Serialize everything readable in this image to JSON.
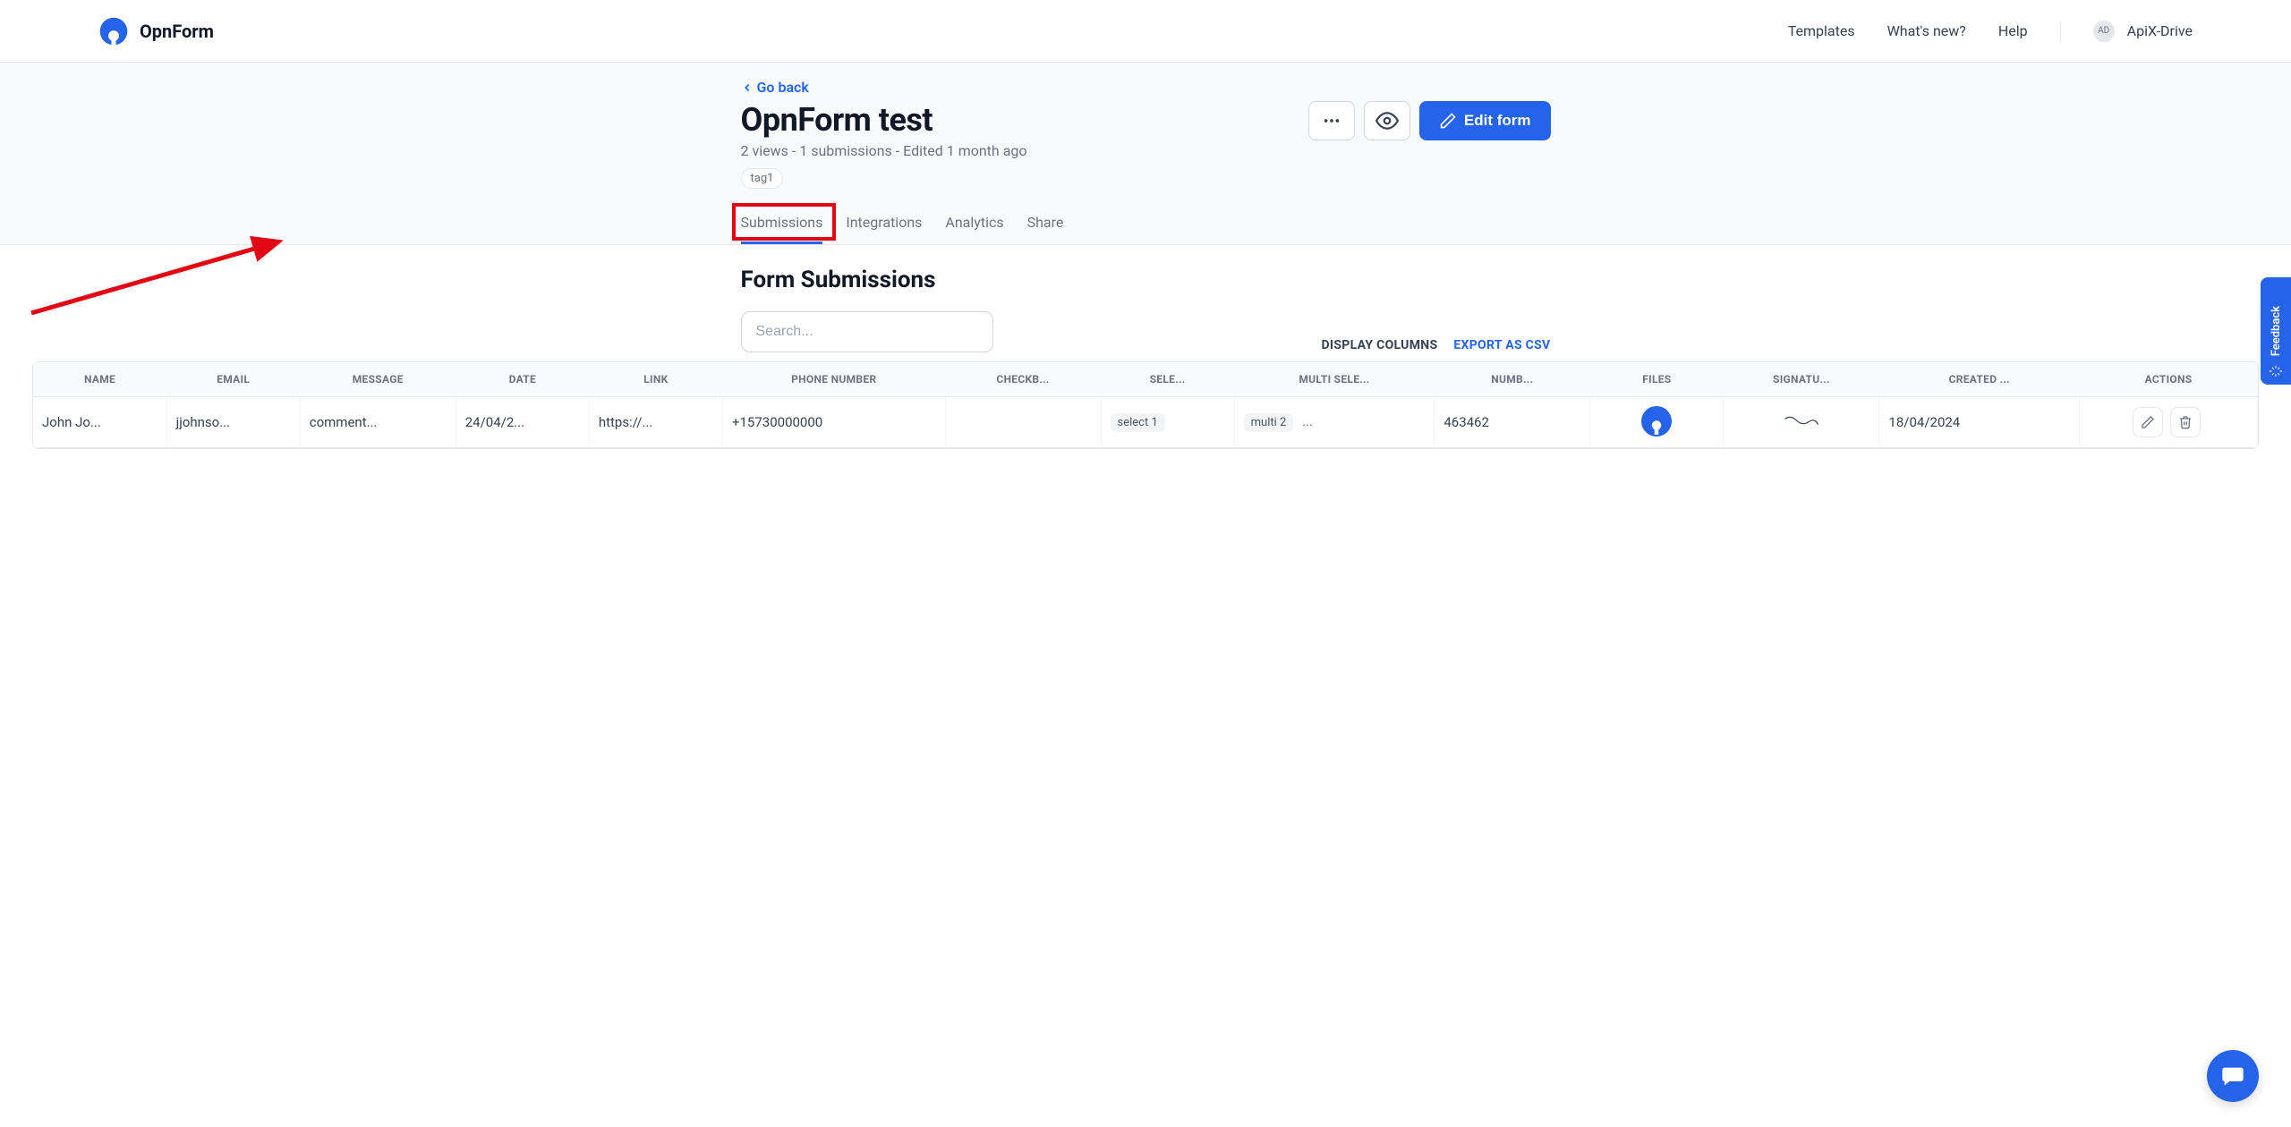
{
  "brand": "OpnForm",
  "nav": {
    "templates": "Templates",
    "whatsnew": "What's new?",
    "help": "Help"
  },
  "account": {
    "initials": "AD",
    "name": "ApiX-Drive"
  },
  "header": {
    "go_back": "Go back",
    "title": "OpnForm test",
    "meta": "2 views - 1 submissions - Edited 1 month ago",
    "tag": "tag1",
    "edit_label": "Edit form"
  },
  "tabs": {
    "submissions": "Submissions",
    "integrations": "Integrations",
    "analytics": "Analytics",
    "share": "Share"
  },
  "section_title": "Form Submissions",
  "search_placeholder": "Search...",
  "list_actions": {
    "display_columns": "DISPLAY COLUMNS",
    "export_csv": "EXPORT AS CSV"
  },
  "columns": {
    "name": "NAME",
    "email": "EMAIL",
    "message": "MESSAGE",
    "date": "DATE",
    "link": "LINK",
    "phone": "PHONE NUMBER",
    "checkbox": "CHECKB...",
    "select": "SELE...",
    "multi": "MULTI SELE...",
    "number": "NUMB...",
    "files": "FILES",
    "signature": "SIGNATU...",
    "created": "CREATED ...",
    "actions": "ACTIONS"
  },
  "row": {
    "name": "John Jo...",
    "email": "jjohnso...",
    "message": "comment...",
    "date": "24/04/2...",
    "link": "https://...",
    "phone": "+15730000000",
    "checkbox": "",
    "select": "select 1",
    "multi1": "multi 2",
    "multi_more": "...",
    "number": "463462",
    "created": "18/04/2024"
  },
  "feedback_label": "Feedback"
}
